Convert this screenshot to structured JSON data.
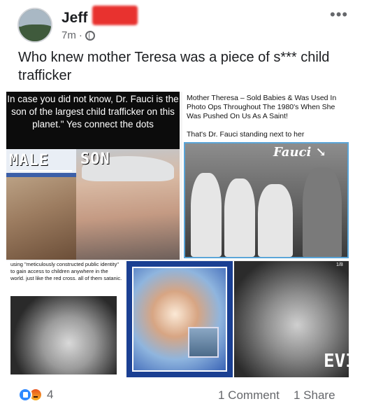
{
  "author": {
    "name": "Jeff",
    "time": "7m",
    "privacy_icon": "globe-icon"
  },
  "post": {
    "caption": "Who knew mother Teresa was a piece of s*** child trafficker",
    "more_icon": "•••"
  },
  "collage": {
    "panel1": {
      "quote": "In case you did not know, Dr. Fauci is the son of the largest child trafficker on this planet.\" Yes connect the dots",
      "label_left": "MALE",
      "label_right": "SON"
    },
    "panel2": {
      "headline": "Mother Theresa – Sold Babies & Was Used In Photo Ops Throughout The 1980's When She Was Pushed On Us As A Saint!",
      "subline": "That's Dr. Fauci standing next to her",
      "handwritten": "Fauci ↘"
    },
    "panel3": {
      "text": "using \"meticulously constructed public identity\" to gain access to children anywhere in the world. just like the red cross. all of them satanic."
    },
    "panel5": {
      "page_indicator": "1/8",
      "overlay_text": "EVI"
    }
  },
  "footer": {
    "reaction_count": "4",
    "comments_label": "1 Comment",
    "shares_label": "1 Share"
  }
}
